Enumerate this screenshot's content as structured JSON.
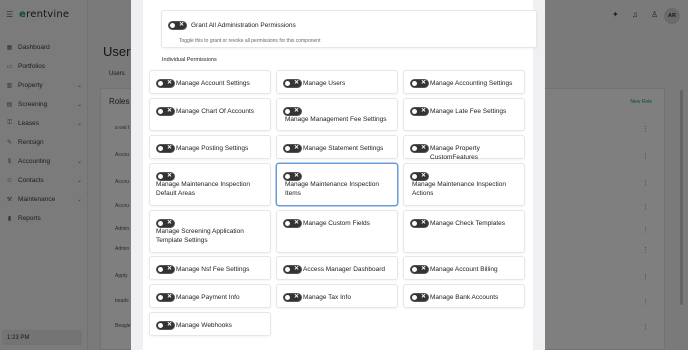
{
  "app": {
    "logo_prefix": "e",
    "logo_text": "rentvine"
  },
  "sidebar": {
    "items": [
      {
        "label": "Dashboard",
        "icon": "grid-icon",
        "chev": ""
      },
      {
        "label": "Portfolios",
        "icon": "folder-icon",
        "chev": ""
      },
      {
        "label": "Property",
        "icon": "building-icon",
        "chev": "⌄"
      },
      {
        "label": "Screening",
        "icon": "doc-icon",
        "chev": "⌄"
      },
      {
        "label": "Leases",
        "icon": "key-icon",
        "chev": "⌄"
      },
      {
        "label": "Rentsign",
        "icon": "pen-icon",
        "chev": ""
      },
      {
        "label": "Accounting",
        "icon": "dollar-icon",
        "chev": "⌄"
      },
      {
        "label": "Contacts",
        "icon": "people-icon",
        "chev": "⌄"
      },
      {
        "label": "Maintenance",
        "icon": "wrench-icon",
        "chev": "⌄"
      },
      {
        "label": "Reports",
        "icon": "chart-icon",
        "chev": ""
      }
    ],
    "clock": "1:23 PM"
  },
  "header": {
    "avatar_initials": "AR"
  },
  "page": {
    "title": "Users",
    "tab": "Users",
    "roles_title": "Roles",
    "new_role": "New Role",
    "role_rows": [
      "a wal t",
      "Accou",
      "Accou",
      "Accou",
      "Admin",
      "Admin",
      "Apply",
      "beads",
      "Beagle"
    ]
  },
  "modal": {
    "grant_label": "Grant All Administration Permissions",
    "grant_help": "Toggle this to grant or revoke all permissions for this component",
    "section_title": "Individual Permissions",
    "permissions": [
      "Manage Account Settings",
      "Manage Users",
      "Manage Accounting Settings",
      "Manage Chart Of Accounts",
      "Manage Management Fee Settings",
      "Manage Late Fee Settings",
      "Manage Posting Settings",
      "Manage Statement Settings",
      "Manage Property CustomFeatures",
      "Manage Maintenance Inspection Default Areas",
      "Manage Maintenance Inspection Items",
      "Manage Maintenance Inspection Actions",
      "Manage Screening Application Template Settings",
      "Manage Custom Fields",
      "Manage Check Templates",
      "Manage Nsf Fee Settings",
      "Access Manager Dashboard",
      "Manage Account Billing",
      "Manage Payment Info",
      "Manage Tax Info",
      "Manage Bank Accounts",
      "Manage Webhooks"
    ]
  },
  "colors": {
    "brand": "#1a9c63",
    "toggle_off": "#333333",
    "focus_border": "#6b9bd8"
  }
}
